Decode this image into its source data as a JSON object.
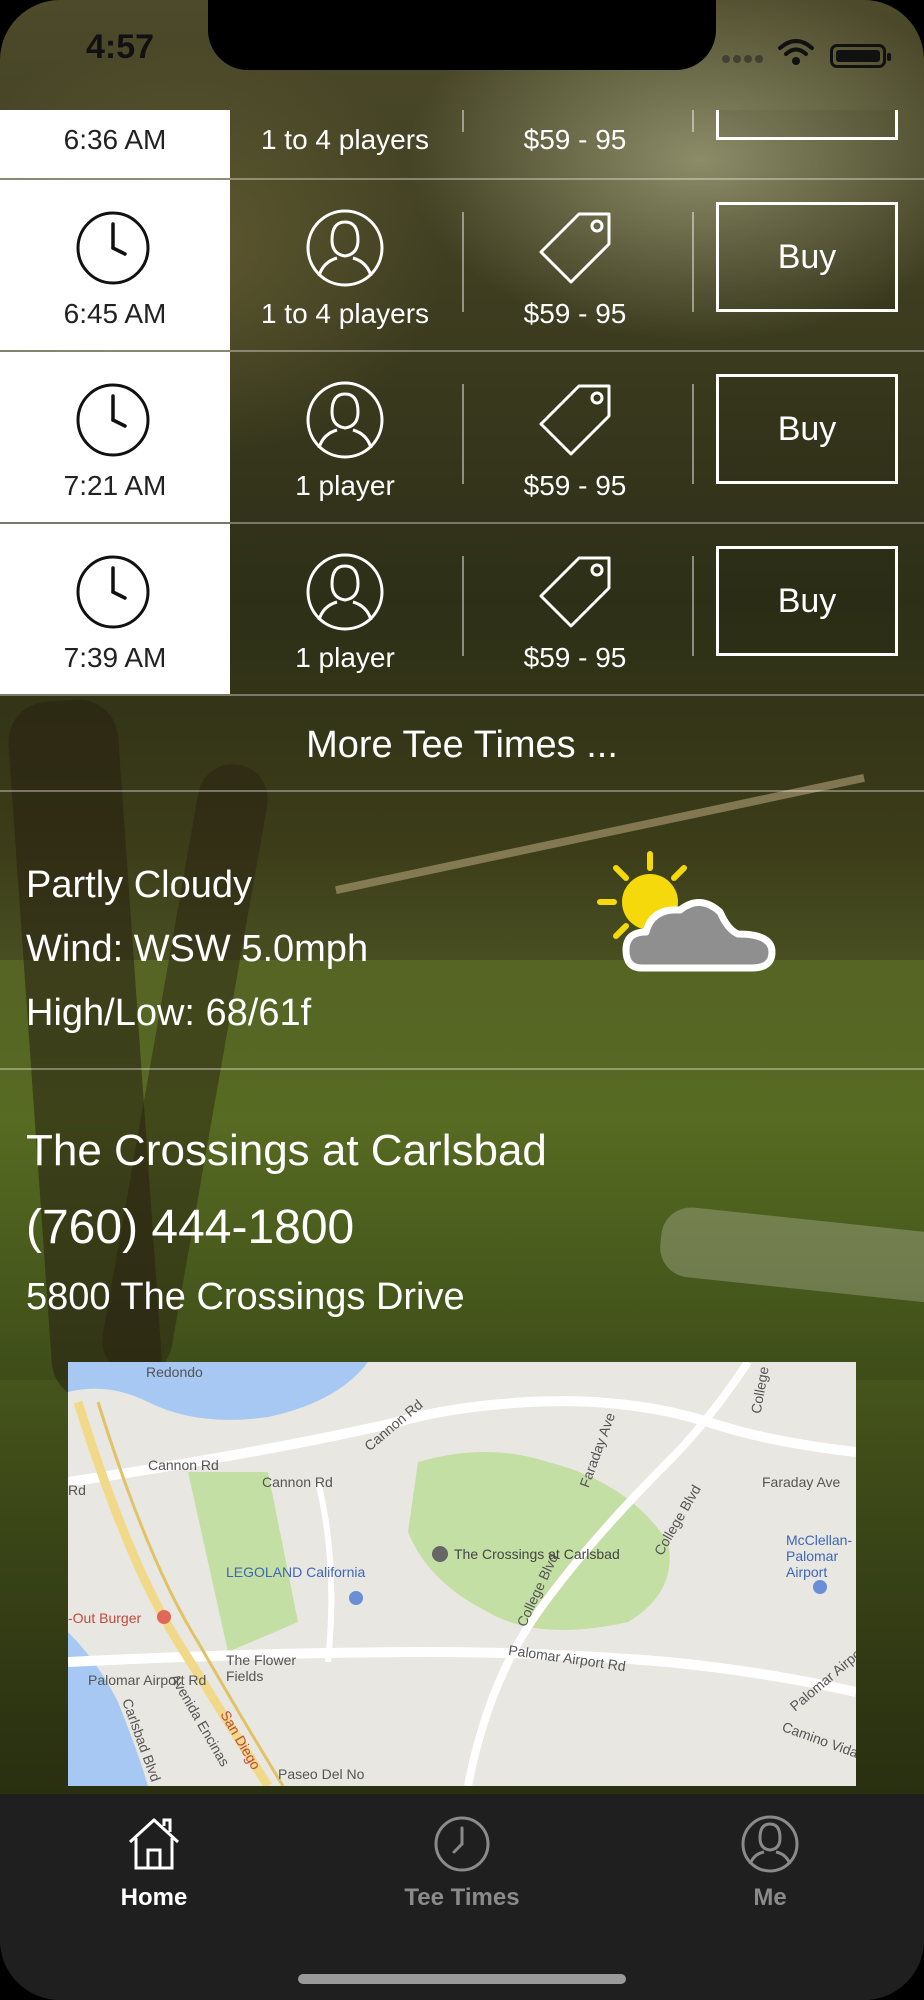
{
  "status_bar": {
    "time": "4:57"
  },
  "tee_times": [
    {
      "time": "6:36 AM",
      "players": "1 to 4 players",
      "price": "$59 - 95",
      "action": ""
    },
    {
      "time": "6:45 AM",
      "players": "1 to 4 players",
      "price": "$59 - 95",
      "action": "Buy"
    },
    {
      "time": "7:21 AM",
      "players": "1 player",
      "price": "$59 - 95",
      "action": "Buy"
    },
    {
      "time": "7:39 AM",
      "players": "1 player",
      "price": "$59 - 95",
      "action": "Buy"
    }
  ],
  "more_tee_times": "More Tee Times ...",
  "weather": {
    "condition": "Partly Cloudy",
    "wind": "Wind: WSW 5.0mph",
    "high_low": "High/Low: 68/61f",
    "icon": "partly-cloudy-icon"
  },
  "course": {
    "name": "The Crossings at Carlsbad",
    "phone": "(760) 444-1800",
    "address": "5800 The Crossings Drive"
  },
  "map": {
    "labels": {
      "redondo": "Redondo",
      "cannon_rd_1": "Cannon Rd",
      "cannon_rd_2": "Cannon Rd",
      "cannon_rd_3": "Cannon Rd",
      "faraday_ave_1": "Faraday Ave",
      "faraday_ave_2": "Faraday Ave",
      "college_blvd_1": "College Blvd",
      "college_blvd_2": "College Blvd",
      "college_top": "College",
      "the_crossings": "The Crossings at Carlsbad",
      "legoland": "LEGOLAND California",
      "mcclellan": "McClellan-Palomar Airport",
      "out_burger": "-Out Burger",
      "flower_fields": "The Flower Fields",
      "palomar_airport_rd_1": "Palomar Airport Rd",
      "palomar_airport_rd_2": "Palomar Airport Rd",
      "palomar_airport_rd_3": "Palomar Airport Rd",
      "san_diego": "San Diego",
      "avenida_encinas": "Avenida Encinas",
      "carlsbad_blvd": "Carlsbad Blvd",
      "camino_vida": "Camino Vida R",
      "paseo_del_no": "Paseo Del No",
      "rd": "Rd"
    }
  },
  "tab_bar": {
    "tabs": [
      {
        "label": "Home",
        "icon": "home-icon",
        "active": true
      },
      {
        "label": "Tee Times",
        "icon": "clock-icon",
        "active": false
      },
      {
        "label": "Me",
        "icon": "person-icon",
        "active": false
      }
    ]
  },
  "colors": {
    "accent": "#ffffff",
    "tab_bar_bg": "#1f1f1f",
    "inactive_tab": "#8a8a8a",
    "sun": "#f5d90a",
    "cloud": "#8f8f8f"
  }
}
